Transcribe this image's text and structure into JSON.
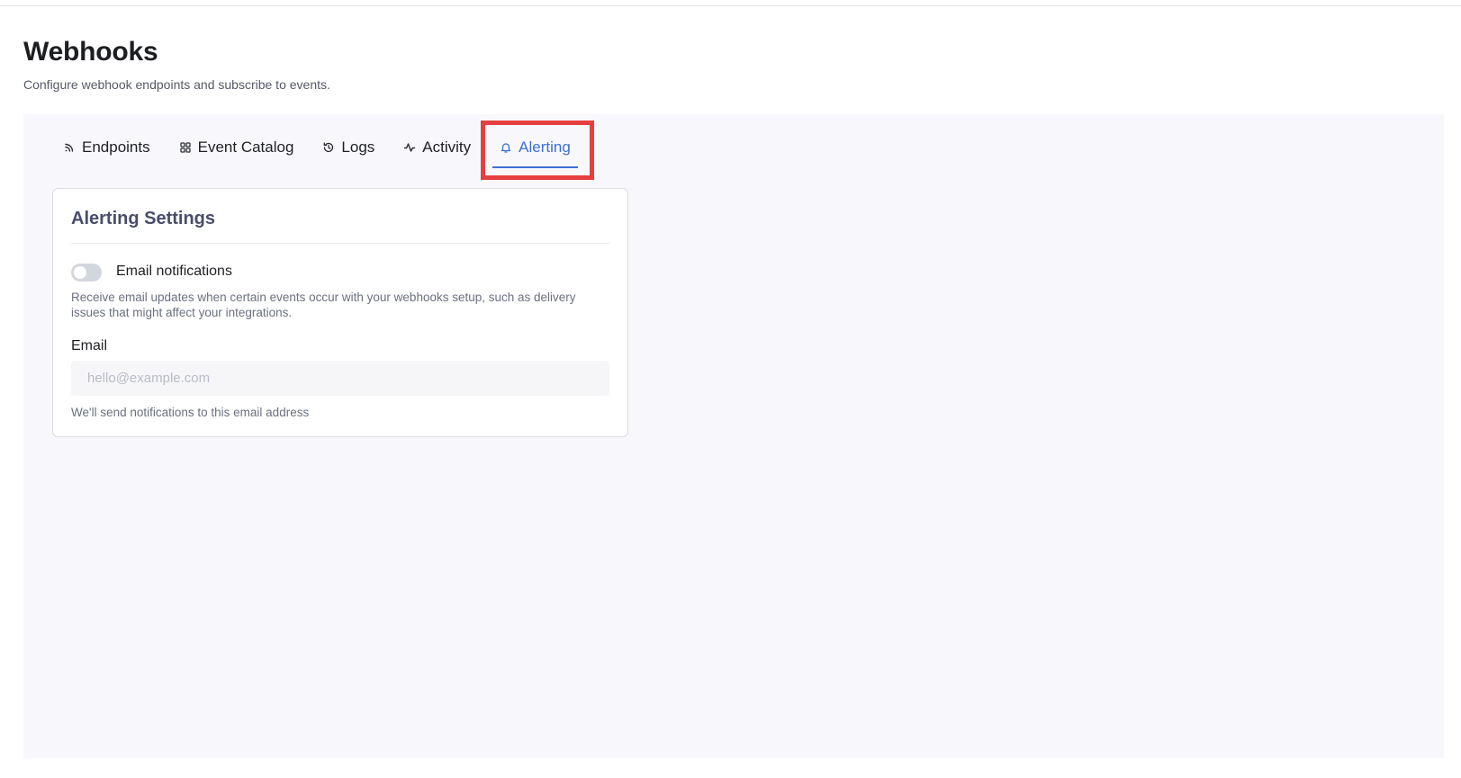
{
  "page": {
    "title": "Webhooks",
    "subtitle": "Configure webhook endpoints and subscribe to events."
  },
  "tabs": [
    {
      "label": "Endpoints",
      "icon": "rss-icon",
      "active": false
    },
    {
      "label": "Event Catalog",
      "icon": "grid-icon",
      "active": false
    },
    {
      "label": "Logs",
      "icon": "history-icon",
      "active": false
    },
    {
      "label": "Activity",
      "icon": "activity-icon",
      "active": false
    },
    {
      "label": "Alerting",
      "icon": "bell-icon",
      "active": true
    }
  ],
  "alerting": {
    "title": "Alerting Settings",
    "email_notifications_label": "Email notifications",
    "email_notifications_enabled": false,
    "email_notifications_description": "Receive email updates when certain events occur with your webhooks setup, such as delivery issues that might affect your integrations.",
    "email_label": "Email",
    "email_value": "",
    "email_placeholder": "hello@example.com",
    "email_help": "We'll send notifications to this email address"
  },
  "colors": {
    "accent": "#3d6fd1",
    "highlight": "#e5403f",
    "panel_bg": "#f8f8fc"
  }
}
